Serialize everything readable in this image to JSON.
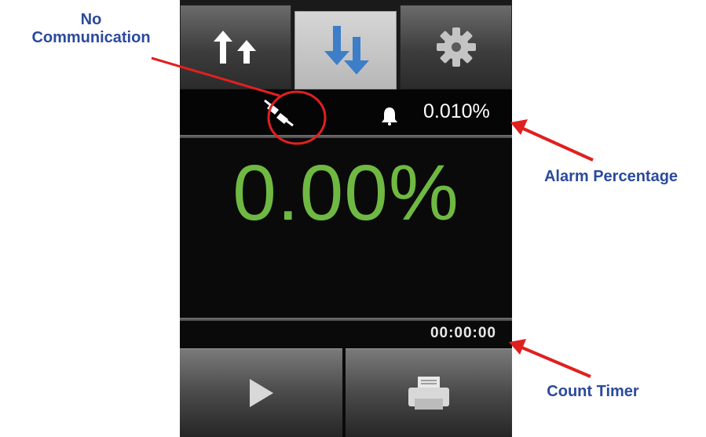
{
  "tabs": [
    {
      "name": "sort-up-icon"
    },
    {
      "name": "sort-down-icon",
      "active": true
    },
    {
      "name": "gear-icon"
    }
  ],
  "status": {
    "comm_icon": "unplugged-icon",
    "alarm_icon": "bell-icon",
    "alarm_value": "0.010%"
  },
  "readout": {
    "value": "0.00%",
    "color": "#6fb943"
  },
  "timer": {
    "value": "00:00:00"
  },
  "bottom": {
    "play_icon": "play-icon",
    "print_icon": "printer-icon"
  },
  "callouts": {
    "no_comm": "No Communication",
    "no_comm_line1": "No",
    "no_comm_line2": "Communication",
    "alarm": "Alarm Percentage",
    "timer": "Count Timer",
    "color": "#2b4a9c",
    "arrow_color": "#e02020"
  }
}
